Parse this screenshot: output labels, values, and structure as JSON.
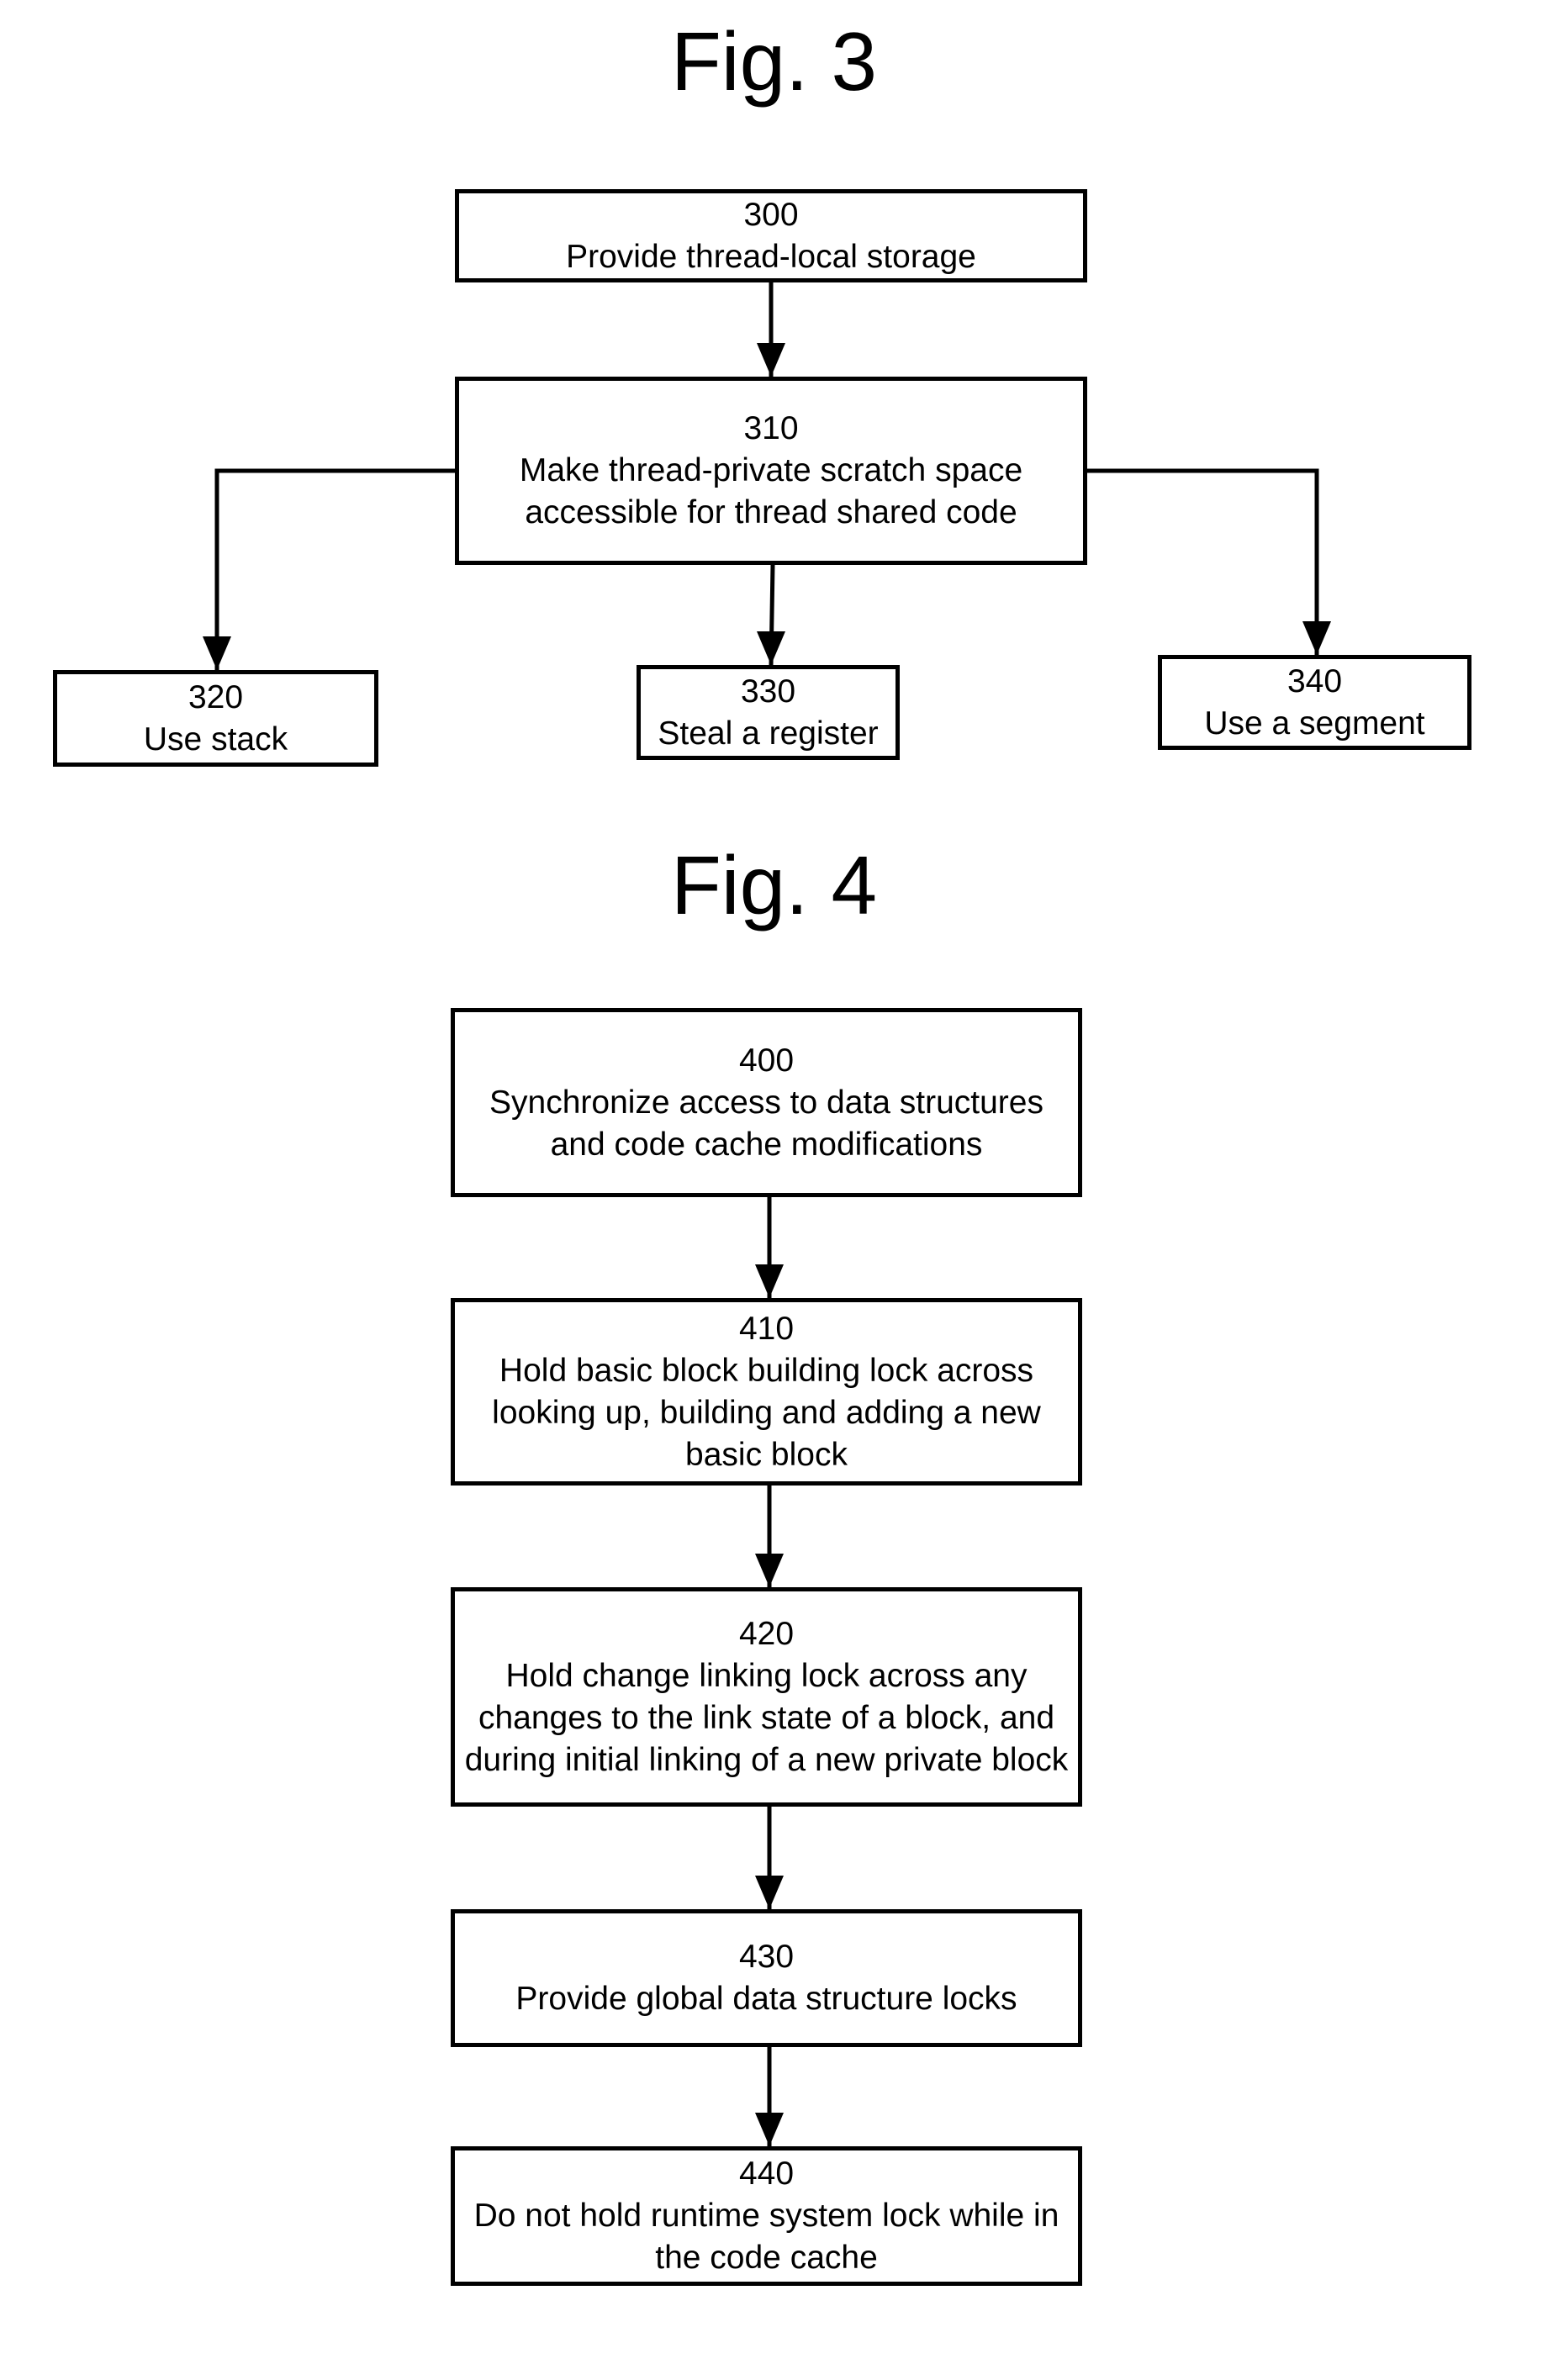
{
  "fig3": {
    "title": "Fig. 3",
    "nodes": [
      {
        "id": "300",
        "text": "Provide thread-local storage"
      },
      {
        "id": "310",
        "text": "Make thread-private scratch space accessible for thread shared code"
      },
      {
        "id": "320",
        "text": "Use stack"
      },
      {
        "id": "330",
        "text": "Steal a register"
      },
      {
        "id": "340",
        "text": "Use a segment"
      }
    ],
    "edges": [
      [
        "300",
        "310"
      ],
      [
        "310",
        "320"
      ],
      [
        "310",
        "330"
      ],
      [
        "310",
        "340"
      ]
    ]
  },
  "fig4": {
    "title": "Fig. 4",
    "nodes": [
      {
        "id": "400",
        "text": "Synchronize access to data structures and code cache modifications"
      },
      {
        "id": "410",
        "text": "Hold basic block building lock across looking up, building and adding a new basic block"
      },
      {
        "id": "420",
        "text": "Hold change linking lock across any changes to the link state of a block, and during initial linking of a new private block"
      },
      {
        "id": "430",
        "text": "Provide global data structure locks"
      },
      {
        "id": "440",
        "text": "Do not hold runtime system lock while in the code cache"
      }
    ],
    "edges": [
      [
        "400",
        "410"
      ],
      [
        "410",
        "420"
      ],
      [
        "420",
        "430"
      ],
      [
        "430",
        "440"
      ]
    ]
  }
}
